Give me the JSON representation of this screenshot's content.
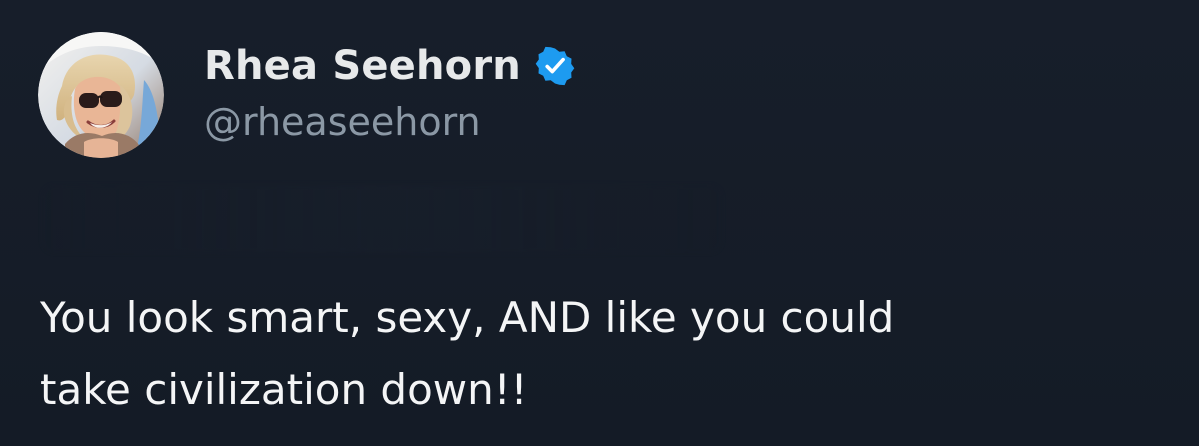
{
  "tweet": {
    "author": {
      "display_name": "Rhea Seehorn",
      "handle": "@rheaseehorn",
      "verified": true,
      "avatar_icon": "profile-photo",
      "verified_icon": "verified-badge-icon"
    },
    "text": "You look smart, sexy, AND like you could\ntake civilization down!!"
  },
  "colors": {
    "background": "#161d28",
    "primary_text": "#e7e9ea",
    "secondary_text": "#8b98a5",
    "verified_blue": "#1d9bf0"
  }
}
